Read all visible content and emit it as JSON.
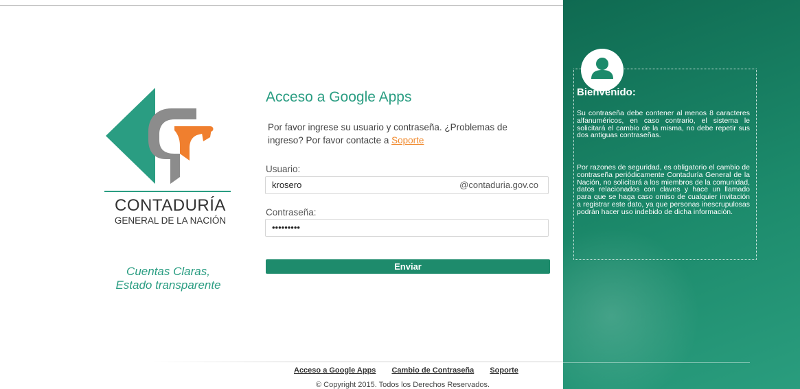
{
  "logo": {
    "name": "CONTADURÍA",
    "subtitle": "GENERAL DE LA NACIÓN",
    "tagline": [
      "Cuentas Claras,",
      "Estado transparente"
    ]
  },
  "form": {
    "title": "Acceso a Google Apps",
    "intro": "Por favor ingrese su usuario y contraseña. ¿Problemas de ingreso? Por favor contacte a",
    "support_link": "Soporte",
    "user_label": "Usuario:",
    "user_value": "krosero",
    "user_domain": "@contaduria.gov.co",
    "password_label": "Contraseña:",
    "password_value": "•••••••••",
    "submit_label": "Enviar"
  },
  "welcome": {
    "title": "Bienvenido:",
    "paragraph1": "Su contraseña debe contener al menos 8 caracteres alfanuméricos, en caso contrario, el sistema le solicitará el cambio de la misma, no debe repetir sus dos antiguas contraseñas.",
    "paragraph2": "Por razones de seguridad, es obligatorio el cambio de contraseña periódicamente Contaduría General de la Nación, no solicitará a los miembros de la comunidad, datos relacionados con claves y hace un llamado para que se haga caso omiso de cualquier invitación a registrar este dato, ya que personas inescrupulosas podrán hacer uso indebido de dicha información."
  },
  "footer": {
    "links": [
      "Acceso a Google Apps",
      "Cambio de Contraseña",
      "Soporte"
    ],
    "copyright": "© Copyright 2015. Todos los Derechos Reservados."
  },
  "colors": {
    "brand_green": "#2a9d82",
    "button_green": "#1e8b6c",
    "panel_green": "#177a5f",
    "link_orange": "#f08a2e",
    "logo_gray": "#8c8c8c"
  },
  "icons": [
    "user-avatar-icon"
  ]
}
